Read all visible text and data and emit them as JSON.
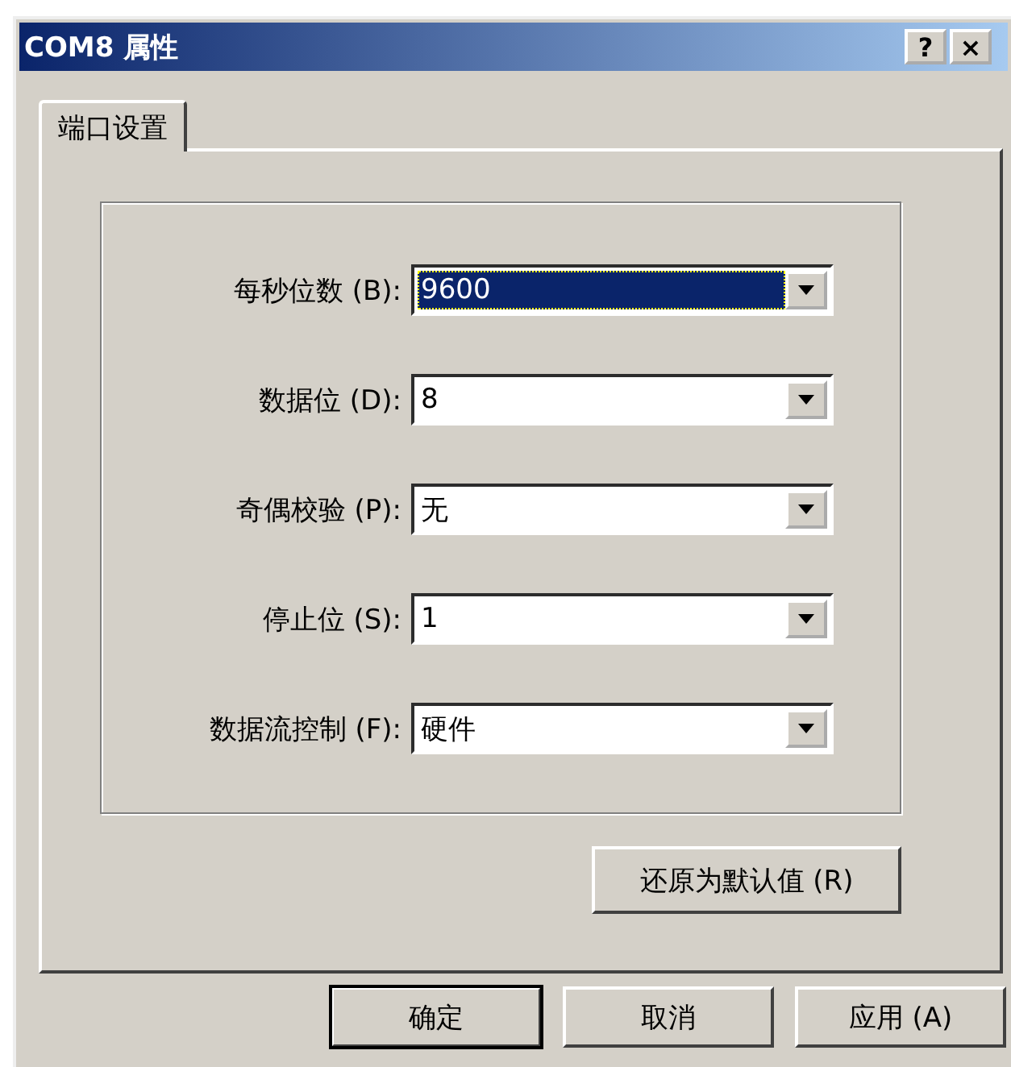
{
  "window": {
    "title": "COM8 属性",
    "help_button": "?",
    "close_button": "×"
  },
  "tabs": [
    {
      "label": "端口设置",
      "selected": true
    }
  ],
  "fields": [
    {
      "label": "每秒位数 (B):",
      "value": "9600",
      "focused": true
    },
    {
      "label": "数据位 (D):",
      "value": "8",
      "focused": false
    },
    {
      "label": "奇偶校验 (P):",
      "value": "无",
      "focused": false
    },
    {
      "label": "停止位 (S):",
      "value": "1",
      "focused": false
    },
    {
      "label": "数据流控制 (F):",
      "value": "硬件",
      "focused": false
    }
  ],
  "restore_button": "还原为默认值 (R)",
  "buttons": [
    {
      "label": "确定",
      "default": true
    },
    {
      "label": "取消",
      "default": false
    },
    {
      "label": "应用 (A)",
      "default": false
    }
  ]
}
